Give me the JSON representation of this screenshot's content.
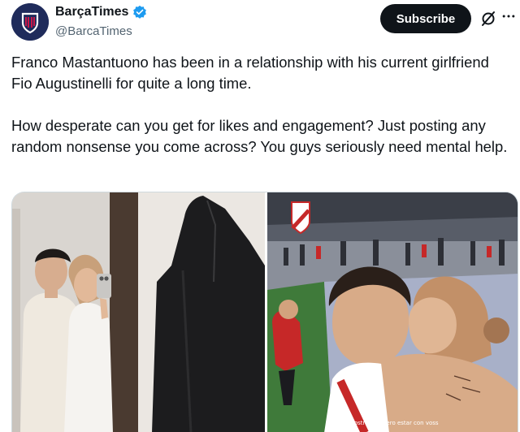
{
  "tweet": {
    "author": {
      "display_name": "BarçaTimes",
      "handle": "@BarcaTimes",
      "verified": true,
      "avatar_icon": "barcatimes-logo-icon"
    },
    "actions": {
      "subscribe_label": "Subscribe",
      "grok_icon": "grok-icon",
      "more_icon": "more-options-icon"
    },
    "paragraphs": [
      "Franco Mastantuono has been in a relationship with his current girlfriend Fio Augustinelli for quite a long time.",
      "How desperate can you get for likes and engagement? Just posting any random nonsense you come across? You guys seriously need mental help."
    ],
    "media": {
      "photo_right_caption": "mostrar yo kiero estar con voss"
    }
  },
  "colors": {
    "text": "#0f1419",
    "secondary": "#536471",
    "verified_blue": "#1d9bf0",
    "subscribe_bg": "#0f1419"
  }
}
